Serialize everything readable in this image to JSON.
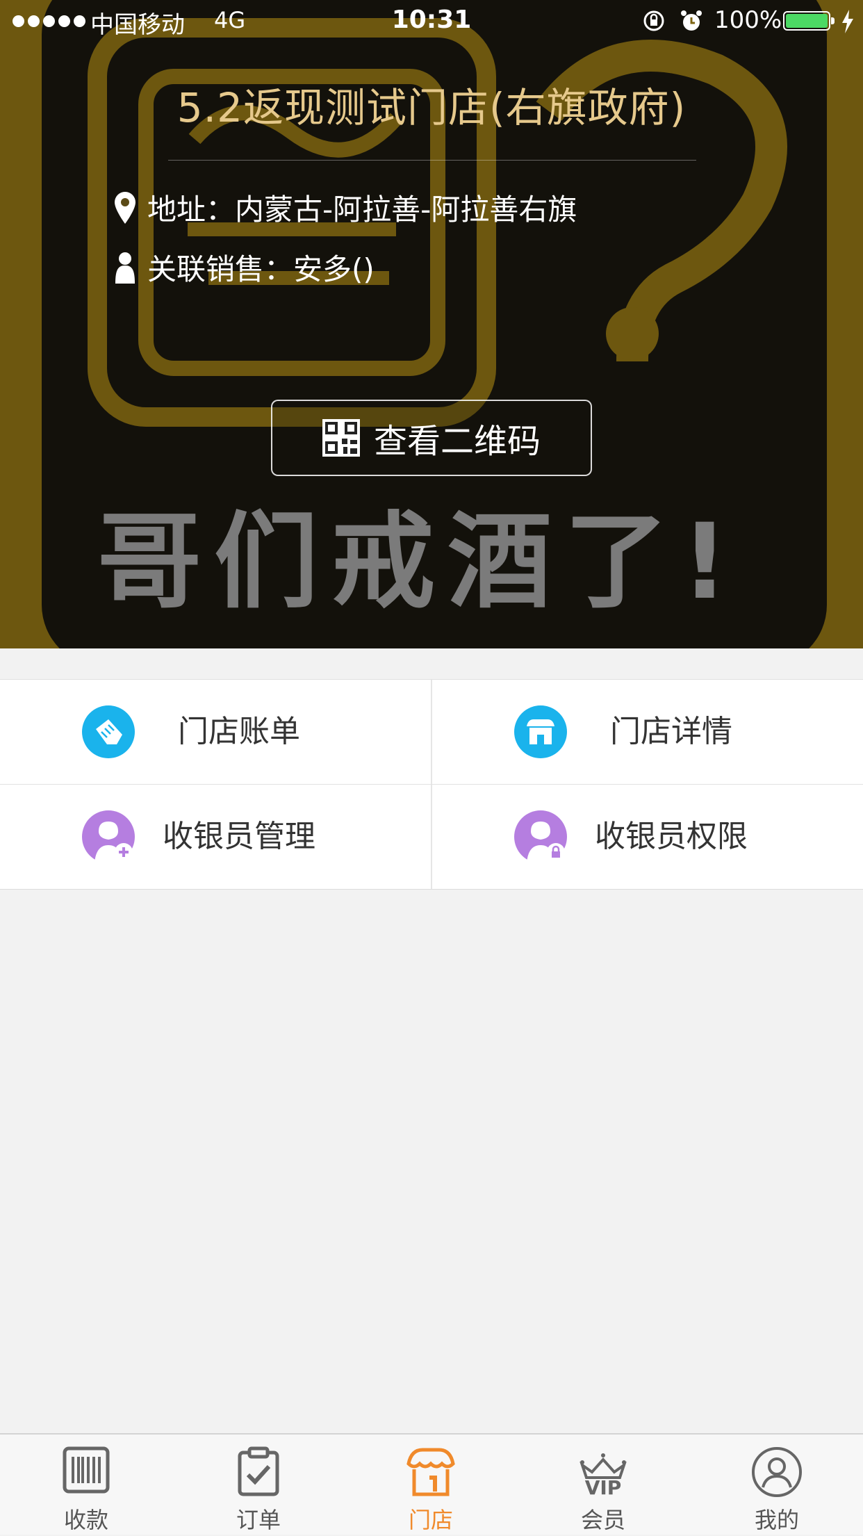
{
  "status_bar": {
    "carrier": "中国移动",
    "network": "4G",
    "time": "10:31",
    "battery": "100%",
    "battery_level": 1.0
  },
  "hero": {
    "store_title": "5.2返现测试门店(右旗政府)",
    "address_label": "地址：",
    "address_value": "内蒙古-阿拉善-阿拉善右旗",
    "sales_label": "关联销售：",
    "sales_value": "安多()",
    "qr_button_label": "查看二维码",
    "background_slogan": "哥们戒酒了!"
  },
  "menu": {
    "items": [
      {
        "label": "门店账单",
        "icon": "bill-icon",
        "color": "#1ab3ec"
      },
      {
        "label": "门店详情",
        "icon": "store-icon",
        "color": "#1ab3ec"
      },
      {
        "label": "收银员管理",
        "icon": "cashier-add-icon",
        "color": "#b57ee0"
      },
      {
        "label": "收银员权限",
        "icon": "cashier-lock-icon",
        "color": "#b57ee0"
      }
    ]
  },
  "tabbar": {
    "tabs": [
      {
        "label": "收款",
        "icon": "barcode-icon",
        "active": false
      },
      {
        "label": "订单",
        "icon": "clipboard-icon",
        "active": false
      },
      {
        "label": "门店",
        "icon": "store-tab-icon",
        "active": true
      },
      {
        "label": "会员",
        "icon": "vip-crown-icon",
        "active": false
      },
      {
        "label": "我的",
        "icon": "profile-icon",
        "active": false
      }
    ],
    "vip_text": "VIP",
    "active_color": "#f08a2b",
    "inactive_color": "#555555"
  },
  "colors": {
    "hero_bg": "#7d6412",
    "title": "#e6c98c",
    "page_bg": "#f2f2f2"
  }
}
